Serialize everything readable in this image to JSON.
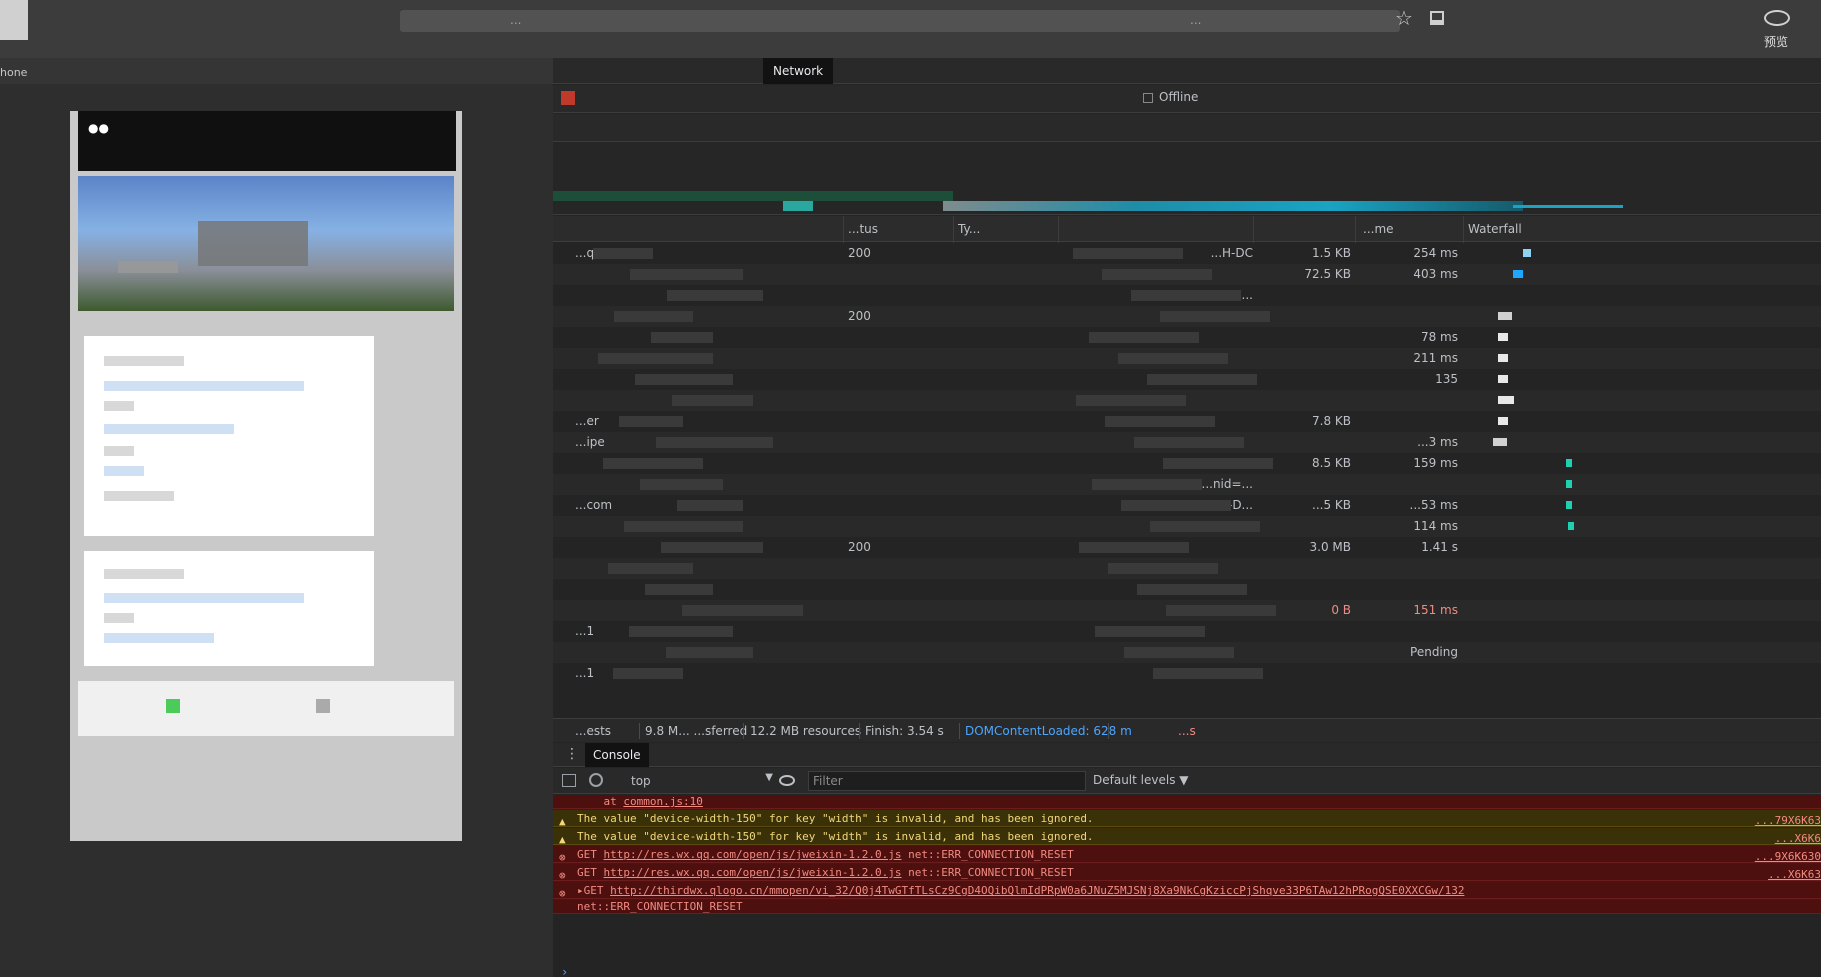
{
  "browser": {
    "address_text": "...",
    "address_tail": "...",
    "preview_label": "预览"
  },
  "device": {
    "label": "hone"
  },
  "devtools": {
    "tabs": [
      "Network"
    ],
    "offline_label": "Offline",
    "columns": {
      "status": "...tus",
      "type": "Ty...",
      "time": "...me",
      "waterfall": "Waterfall"
    },
    "rows": [
      {
        "name": "...q=5",
        "status": "200",
        "initiator": "...H-DC",
        "size": "1.5 KB",
        "time": "254 ms",
        "err": false
      },
      {
        "name": "",
        "status": "",
        "initiator": "",
        "size": "72.5 KB",
        "time": "403 ms",
        "err": false
      },
      {
        "name": "",
        "status": "",
        "initiator": "...CH-D...",
        "size": "",
        "time": "",
        "err": false
      },
      {
        "name": "",
        "status": "200",
        "initiator": "...C...D...",
        "size": "",
        "time": "",
        "err": false
      },
      {
        "name": "",
        "status": "",
        "initiator": "",
        "size": "",
        "time": "78 ms",
        "err": false
      },
      {
        "name": "",
        "status": "",
        "initiator": "",
        "size": "",
        "time": "211 ms",
        "err": false
      },
      {
        "name": "",
        "status": "",
        "initiator": "...-D...",
        "size": "",
        "time": "135",
        "err": false
      },
      {
        "name": "",
        "status": "",
        "initiator": "",
        "size": "",
        "time": "",
        "err": false
      },
      {
        "name": "...er",
        "status": "",
        "initiator": "",
        "size": "7.8 KB",
        "time": "",
        "err": false
      },
      {
        "name": "...ipe",
        "status": "",
        "initiator": "",
        "size": "",
        "time": "...3 ms",
        "err": false
      },
      {
        "name": "",
        "status": "",
        "initiator": "",
        "size": "8.5 KB",
        "time": "159 ms",
        "err": false
      },
      {
        "name": "",
        "status": "",
        "initiator": "...nid=...",
        "size": "",
        "time": "",
        "err": false
      },
      {
        "name": "...com",
        "status": "",
        "initiator": "...CH-D...",
        "size": "...5 KB",
        "time": "...53 ms",
        "err": false
      },
      {
        "name": "",
        "status": "",
        "initiator": "",
        "size": "",
        "time": "114 ms",
        "err": false
      },
      {
        "name": "",
        "status": "200",
        "initiator": "",
        "size": "3.0 MB",
        "time": "1.41 s",
        "err": false
      },
      {
        "name": "",
        "status": "",
        "initiator": "",
        "size": "",
        "time": "",
        "err": false
      },
      {
        "name": "",
        "status": "",
        "initiator": "",
        "size": "",
        "time": "",
        "err": false
      },
      {
        "name": "",
        "status": "",
        "initiator": "",
        "size": "0 B",
        "time": "151 ms",
        "err": true
      },
      {
        "name": "...1",
        "status": "",
        "initiator": "",
        "size": "",
        "time": "",
        "err": false
      },
      {
        "name": "",
        "status": "",
        "initiator": "",
        "size": "",
        "time": "Pending",
        "err": false
      },
      {
        "name": "...1",
        "status": "",
        "initiator": "",
        "size": "",
        "time": "",
        "err": false
      }
    ],
    "summary": {
      "requests": "...ests",
      "transferred": "9.8 M... ...sferred",
      "resources": "12.2 MB resources",
      "finish": "Finish: 3.54 s",
      "dcl": "DOMContentLoaded: 628 m",
      "load": "...s"
    },
    "drawer_tab": "Console",
    "console": {
      "context": "top",
      "filter_placeholder": "Filter",
      "levels": "Default levels ▼",
      "messages": [
        {
          "type": "error",
          "icon": "",
          "text": "    at ",
          "link": "common.js:10",
          "tail": "",
          "right": ""
        },
        {
          "type": "warn",
          "icon": "▲",
          "text": "The value \"device-width-150\" for key \"width\" is invalid, and has been ignored.",
          "link": "",
          "tail": "",
          "right": "...79X6K63"
        },
        {
          "type": "warn",
          "icon": "▲",
          "text": "The value \"device-width-150\" for key \"width\" is invalid, and has been ignored.",
          "link": "",
          "tail": "",
          "right": "...X6K6"
        },
        {
          "type": "error",
          "icon": "⊗",
          "text": "GET ",
          "link": "http://res.wx.qq.com/open/js/jweixin-1.2.0.js",
          "tail": " net::ERR_CONNECTION_RESET",
          "right": "...9X6K630"
        },
        {
          "type": "error",
          "icon": "⊗",
          "text": "GET ",
          "link": "http://res.wx.qq.com/open/js/jweixin-1.2.0.js",
          "tail": " net::ERR_CONNECTION_RESET",
          "right": "...X6K63"
        },
        {
          "type": "error",
          "icon": "⊗",
          "text": "▸GET ",
          "link": "http://thirdwx.qlogo.cn/mmopen/vi_32/Q0j4TwGTfTLsCz9CgD4OQibQlmIdPRpW0a6JNuZ5MJSNj8Xa9NkCgKziccPjShqve33P6TAw12hPRogQSE0XXCGw/132",
          "tail": "",
          "right": ""
        },
        {
          "type": "error",
          "icon": "",
          "text": "net::ERR_CONNECTION_RESET",
          "link": "",
          "tail": "",
          "right": ""
        }
      ]
    }
  }
}
